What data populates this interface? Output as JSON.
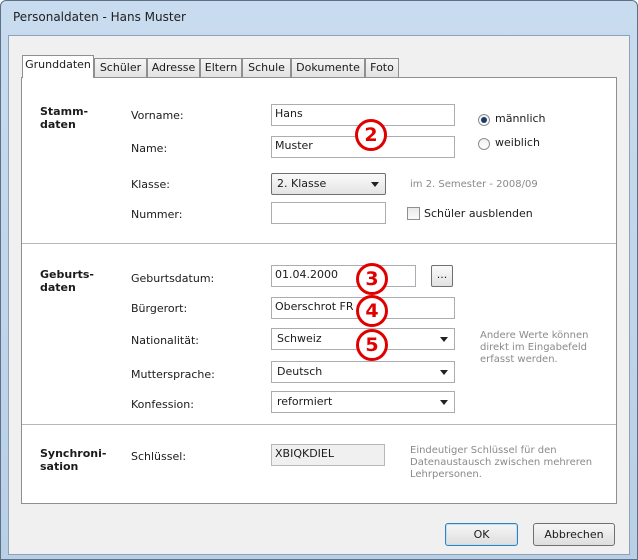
{
  "window": {
    "title": "Personaldaten - Hans Muster"
  },
  "tabs": [
    {
      "label": "Grunddaten",
      "active": true
    },
    {
      "label": "Schüler"
    },
    {
      "label": "Adresse"
    },
    {
      "label": "Eltern"
    },
    {
      "label": "Schule"
    },
    {
      "label": "Dokumente"
    },
    {
      "label": "Foto"
    }
  ],
  "stammdaten": {
    "heading": "Stamm-\ndaten",
    "vorname_label": "Vorname:",
    "vorname_value": "Hans",
    "name_label": "Name:",
    "name_value": "Muster",
    "gender_male": "männlich",
    "gender_female": "weiblich",
    "gender_selected": "männlich",
    "klasse_label": "Klasse:",
    "klasse_value": "2. Klasse",
    "klasse_hint": "im 2. Semester - 2008/09",
    "nummer_label": "Nummer:",
    "nummer_value": "",
    "hide_student_label": "Schüler ausblenden",
    "hide_student_checked": false
  },
  "geburtsdaten": {
    "heading": "Geburts-\ndaten",
    "geburtsdatum_label": "Geburtsdatum:",
    "geburtsdatum_value": "01.04.2000",
    "browse_label": "...",
    "buergerort_label": "Bürgerort:",
    "buergerort_value": "Oberschrot FR",
    "nationalitaet_label": "Nationalität:",
    "nationalitaet_value": "Schweiz",
    "muttersprache_label": "Muttersprache:",
    "muttersprache_value": "Deutsch",
    "konfession_label": "Konfession:",
    "konfession_value": "reformiert",
    "hint": "Andere Werte können\ndirekt im Eingabefeld\nerfasst werden."
  },
  "synchronisation": {
    "heading": "Synchroni-\nsation",
    "schluessel_label": "Schlüssel:",
    "schluessel_value": "XBIQKDIEL",
    "hint": "Eindeutiger Schlüssel für den\nDatenaustausch zwischen mehreren\nLehrpersonen."
  },
  "markers": [
    "2",
    "3",
    "4",
    "5"
  ],
  "buttons": {
    "ok": "OK",
    "cancel": "Abbrechen"
  }
}
